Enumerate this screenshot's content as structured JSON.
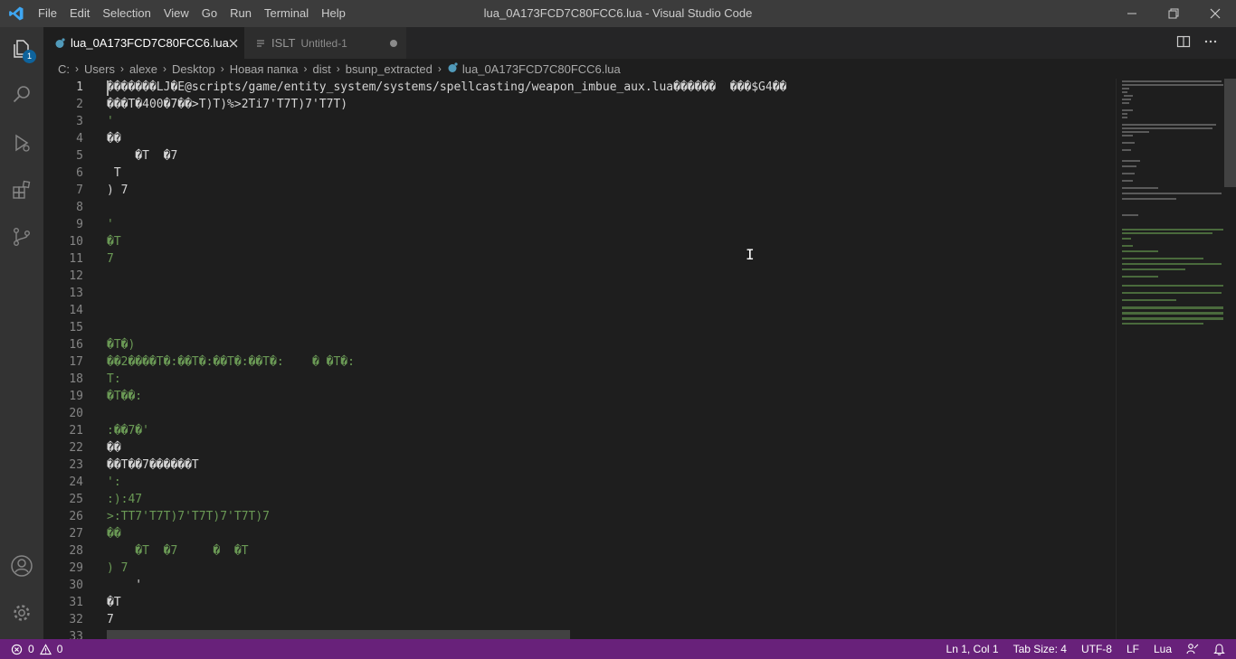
{
  "window": {
    "title": "lua_0A173FCD7C80FCC6.lua - Visual Studio Code"
  },
  "menu": [
    "File",
    "Edit",
    "Selection",
    "View",
    "Go",
    "Run",
    "Terminal",
    "Help"
  ],
  "activity": {
    "explorer_badge": "1"
  },
  "tabs": [
    {
      "label": "lua_0A173FCD7C80FCC6.lua",
      "active": true
    },
    {
      "label": "ISLT",
      "description": "Untitled-1",
      "active": false
    }
  ],
  "breadcrumb": {
    "drive": "C:",
    "parts": [
      "Users",
      "alexe",
      "Desktop",
      "Новая папка",
      "dist",
      "bsunp_extracted"
    ],
    "file": "lua_0A173FCD7C80FCC6.lua"
  },
  "editor": {
    "lines": [
      {
        "n": "1",
        "t": "�������\u0001LJ\u0002�E@scripts/game/entity_system/systems/spellcasting/weapon_imbue_aux.lua�\u0002�����  ���\u0002$G4\u0002��",
        "c": ""
      },
      {
        "n": "2",
        "t": "���T\u0002�400�7\u0002\u0002\u0002\u0002��>\u0002\u0002\u0002T\u0002\u0002)\u0002\u0002\u0002T\u0002\u0002)\u0002\u0002%\u0002\u0002>\u0002\u00022\u0002\u0002\u0002\u0002\u0002\u0002T\u0002i\u00027\u0002\u0002\u0002'\u0002\u0002\u0002\u0002\u0002\u0002T\u0002\u0002\u00027\u0002\u0002\u0002\u0002\u0002\u0002\u0002\u0002\u0002\u0002T\u0002\u0002\u0002)\u0002\u0002\u00027\u0002\u0002\u0002'\u0002\u0002\u0002\u0002\u0002\u0002T\u0002\u0002\u00027\u0002\u0002\u0002\u0002\u0002\u0002\u0002\u0002\u0002\u0002T\u0002\u0002\u0002)",
        "c": ""
      },
      {
        "n": "3",
        "t": "\u0002'",
        "c": "g"
      },
      {
        "n": "4",
        "t": "��\u0002",
        "c": ""
      },
      {
        "n": "5",
        "t": "    �T  \u0002�7",
        "c": ""
      },
      {
        "n": "6",
        "t": "\u0002\u0002\u0002 \u0002T",
        "c": ""
      },
      {
        "n": "7",
        "t": "\u0002\u0002) \u0002\u00027",
        "c": ""
      },
      {
        "n": "8",
        "t": "",
        "c": ""
      },
      {
        "n": "9",
        "t": "\u0002'\u0002\u0002\u0002\u0002\u0002",
        "c": "g"
      },
      {
        "n": "10",
        "t": "�T",
        "c": "g"
      },
      {
        "n": "11",
        "t": "\u0002\u00027",
        "c": "g"
      },
      {
        "n": "12",
        "t": "",
        "c": ""
      },
      {
        "n": "13",
        "t": "\u0002\u0002",
        "c": "g"
      },
      {
        "n": "14",
        "t": "\u0002",
        "c": "g"
      },
      {
        "n": "15",
        "t": "\u0002\u0002",
        "c": "g"
      },
      {
        "n": "16",
        "t": "�T\u0002\u0002�)",
        "c": "g"
      },
      {
        "n": "17",
        "t": "��2\u0002���\u0002�T\u0002\u0002�:\u0002\u0002\u0002\u0002�\u0002�T\u0002\u0002�:\u0002\u0002\u0002\u0002�\u0002�T\u0002\u0002�:\u0002\u0002\u0002\u0002�\u0002�T\u0002\u0002�:\u0002    \u0002\u0002� �T\u0002\u0002�:",
        "c": "g"
      },
      {
        "n": "18",
        "t": "\u0002\u0002\u0002\u0002\u0002T\u0002\u0002\u0002:\u0002\u0002\u0002\u0002\u0002",
        "c": "g"
      },
      {
        "n": "19",
        "t": "�T�\u0002�:",
        "c": "g"
      },
      {
        "n": "20",
        "t": "\u0002\u0002\u0002\u0002\u0002",
        "c": "g"
      },
      {
        "n": "21",
        "t": ":��\u00027�\u0002\u0002'",
        "c": "g"
      },
      {
        "n": "22",
        "t": "��\u0002",
        "c": ""
      },
      {
        "n": "23",
        "t": "��T�\u0002�7�\u0002\u0002\u0002�\u0002�\u0002�\u0002��T",
        "c": ""
      },
      {
        "n": "24",
        "t": "\u0002\u0002'\u0002\u0002\u0002:\u0002",
        "c": "g"
      },
      {
        "n": "25",
        "t": "\u0002:\u0002\u0002\u0002)\u0002\u0002\u0002:\u0002\u0002\u00024\u0002\u0002\u00027\u0002\u0002\u0002\u0002",
        "c": "g"
      },
      {
        "n": "26",
        "t": "\u0002\u0002>\u0002\u0002\u0002:\u0002\u0002\u0002T\u0002\u0002\u0002\u0002\u0002\u0002\u0002T\u0002\u0002\u00027\u0002\u0002\u0002'\u0002\u0002\u0002\u0002\u0002\u0002\u0002T\u0002\u0002\u00027\u0002\u0002\u0002\u0002\u0002\u0002\u0002\u0002\u0002\u0002T\u0002\u0002\u0002)\u0002\u0002\u00027\u0002\u0002\u0002'\u0002\u0002\u0002\u0002\u0002\u0002\u0002T\u0002\u0002\u00027\u0002\u0002\u0002\u0002\u0002\u0002\u0002\u0002\u0002\u0002T\u0002\u0002\u0002)\u0002\u0002\u00027\u0002\u0002\u0002'\u0002\u0002\u0002\u0002\u0002\u0002\u0002T\u0002\u0002\u00027\u0002\u0002\u0002\u0002\u0002\u0002\u0002\u0002\u0002\u0002T\u0002\u0002\u0002)\u0002\u0002\u00027\u0002\u0002",
        "c": "g"
      },
      {
        "n": "27",
        "t": "��\u0002",
        "c": "g"
      },
      {
        "n": "28",
        "t": "    �T  \u0002�7 \u0002\u0002\u0002 \u0002   \u0002�  �T",
        "c": "g"
      },
      {
        "n": "29",
        "t": "\u0002\u0002) \u0002\u00027",
        "c": "g"
      },
      {
        "n": "30",
        "t": "    \u0002'\u0002\u0002\u0002\u0002\u0002",
        "c": ""
      },
      {
        "n": "31",
        "t": "�T",
        "c": ""
      },
      {
        "n": "32",
        "t": "\u0002\u00027",
        "c": ""
      },
      {
        "n": "33",
        "t": "    \u0002\u0002",
        "c": "g"
      }
    ]
  },
  "status": {
    "errors": "0",
    "warnings": "0",
    "position": "Ln 1, Col 1",
    "tab_size": "Tab Size: 4",
    "encoding": "UTF-8",
    "eol": "LF",
    "language": "Lua"
  },
  "colors": {
    "statusbar": "#68217a",
    "titlebar": "#3c3c3c",
    "activitybar": "#333333",
    "editor": "#1e1e1e"
  }
}
